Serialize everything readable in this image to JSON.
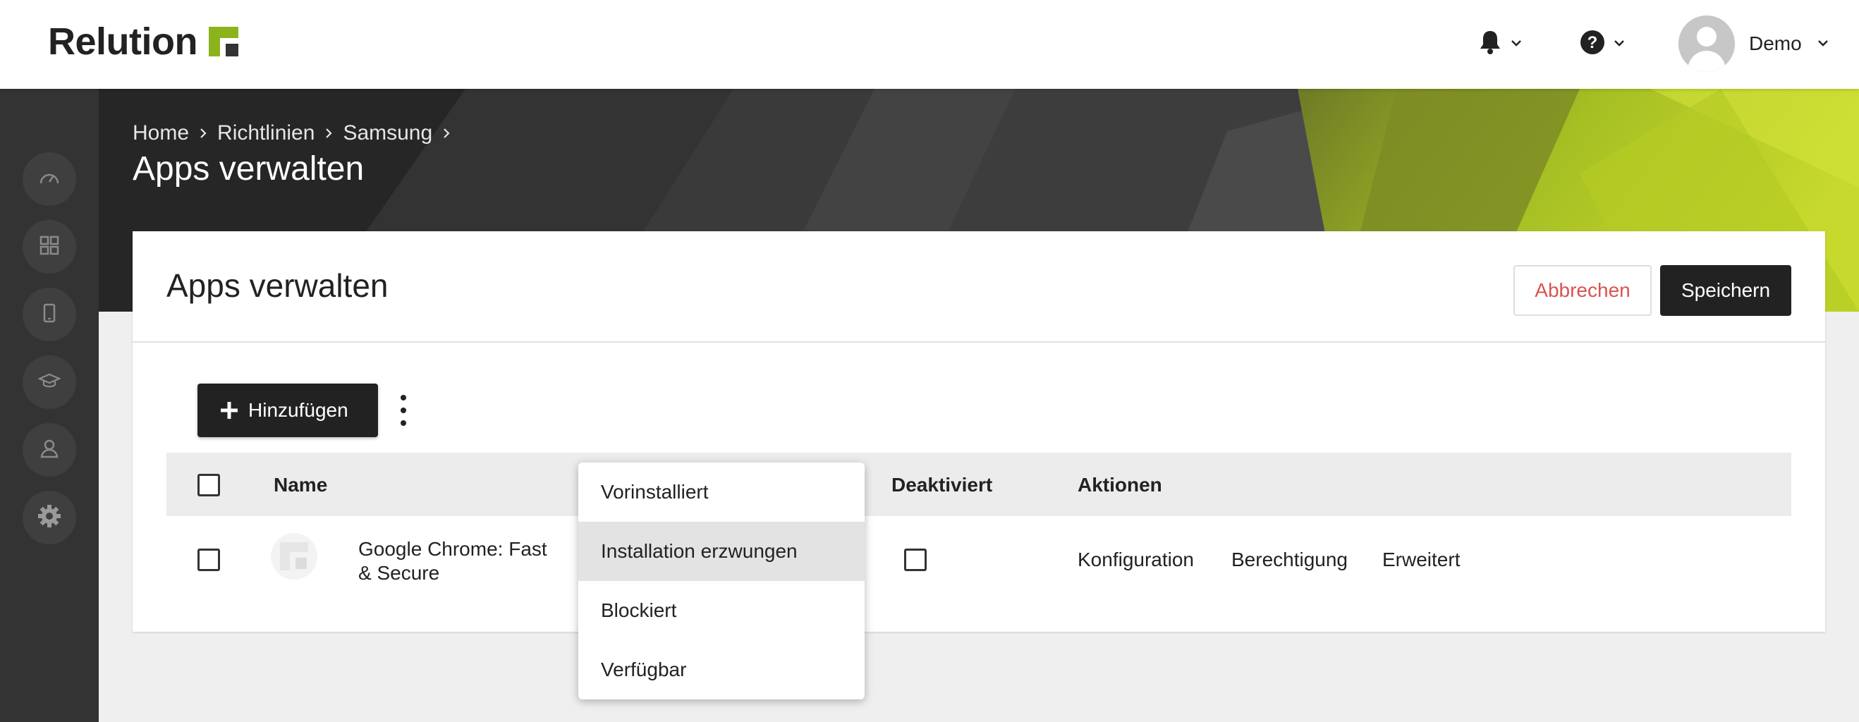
{
  "app": {
    "name": "Relution",
    "brand_color": "#8cb31c"
  },
  "topbar": {
    "notifications_icon": "bell-icon",
    "help_icon": "question-circle-icon",
    "user_name": "Demo"
  },
  "sidebar": {
    "items": [
      {
        "icon": "dashboard-gauge-icon"
      },
      {
        "icon": "apps-grid-icon"
      },
      {
        "icon": "device-phone-icon"
      },
      {
        "icon": "graduation-cap-icon"
      },
      {
        "icon": "user-icon"
      },
      {
        "icon": "gear-icon"
      }
    ]
  },
  "breadcrumb": [
    "Home",
    "Richtlinien",
    "Samsung"
  ],
  "page_title": "Apps verwalten",
  "card": {
    "title": "Apps verwalten",
    "cancel_label": "Abbrechen",
    "save_label": "Speichern",
    "add_label": "Hinzufügen"
  },
  "table": {
    "columns": [
      "Name",
      "Deaktiviert",
      "Aktionen"
    ],
    "rows": [
      {
        "name": "Google Chrome: Fast & Secure",
        "actions": [
          "Konfiguration",
          "Berechtigung",
          "Erweitert"
        ]
      }
    ]
  },
  "dropdown": {
    "options": [
      "Vorinstalliert",
      "Installation erzwungen",
      "Blockiert",
      "Verfügbar"
    ],
    "highlighted": "Installation erzwungen"
  },
  "colors": {
    "cancel_text": "#d9534f",
    "primary_button": "#222222",
    "sidebar": "#333333"
  }
}
